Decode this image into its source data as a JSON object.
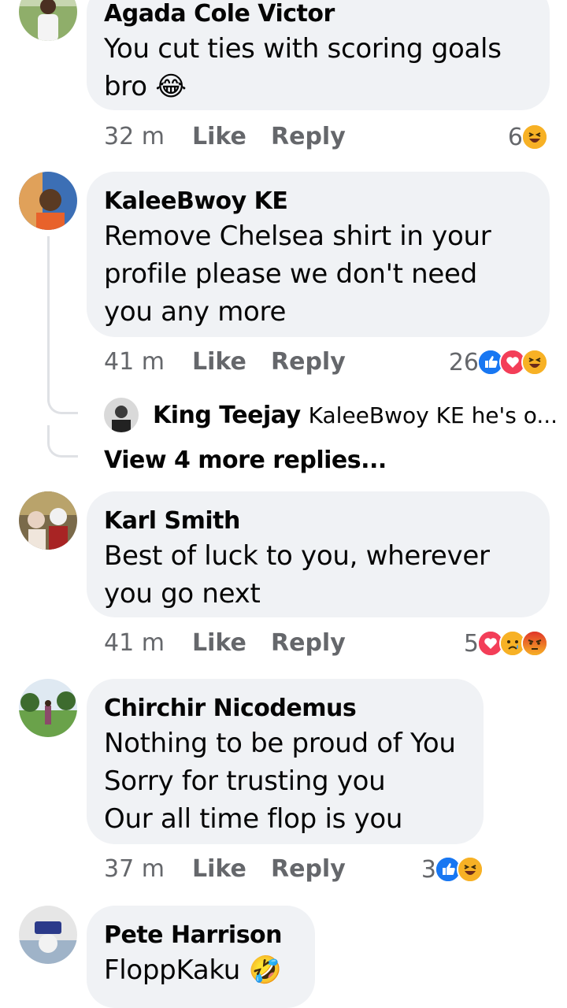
{
  "comments": [
    {
      "author": "Agada Cole Victor",
      "text": "You cut ties with scoring goals bro 😂",
      "time": "32 m",
      "like": "Like",
      "reply": "Reply",
      "reaction_count": "6",
      "reactions": [
        "haha"
      ]
    },
    {
      "author": "KaleeBwoy KE",
      "text": "Remove Chelsea shirt in your\nprofile please we don't need\nyou any more",
      "time": "41 m",
      "like": "Like",
      "reply": "Reply",
      "reaction_count": "26",
      "reactions": [
        "like",
        "love",
        "haha"
      ],
      "reply_preview": {
        "author": "King Teejay",
        "text": "KaleeBwoy KE he's o..."
      },
      "view_more": "View 4 more replies..."
    },
    {
      "author": "Karl Smith",
      "text": "Best of luck to you, wherever\nyou go next",
      "time": "41 m",
      "like": "Like",
      "reply": "Reply",
      "reaction_count": "5",
      "reactions": [
        "love",
        "sad",
        "angry"
      ]
    },
    {
      "author": "Chirchir Nicodemus",
      "text": "Nothing to be proud of You\nSorry for trusting you\nOur all time flop is you",
      "time": "37 m",
      "like": "Like",
      "reply": "Reply",
      "reaction_count": "3",
      "reactions": [
        "like",
        "haha"
      ]
    },
    {
      "author": "Pete Harrison",
      "text": "FloppKaku 🤣"
    }
  ],
  "colors": {
    "bubble": "#f0f2f5",
    "meta": "#65676b",
    "like_blue": "#1877f2",
    "love_red": "#f33e58",
    "haha_yellow": "#f7b125"
  }
}
